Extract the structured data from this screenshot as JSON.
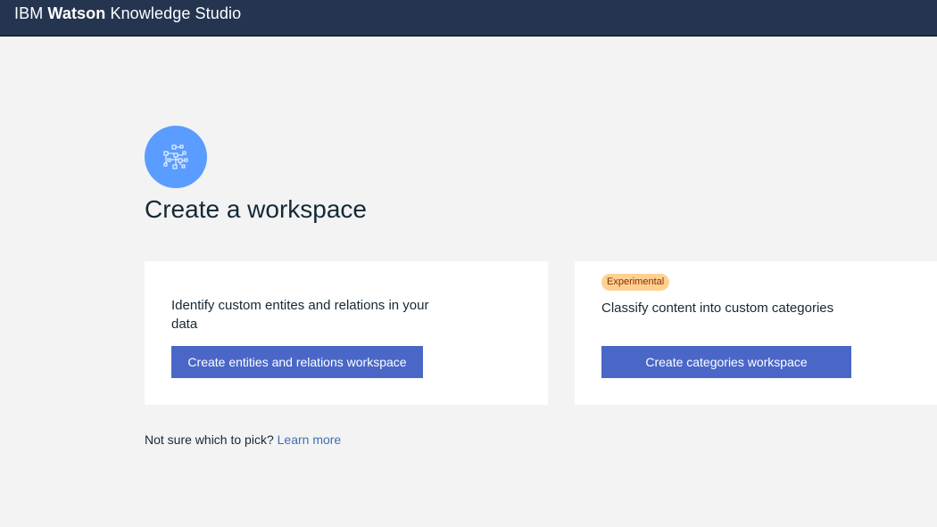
{
  "header": {
    "brand_ibm": "IBM",
    "brand_watson": "Watson",
    "brand_product": "Knowledge Studio"
  },
  "hero": {
    "icon": "workspace-network-icon",
    "icon_color": "#5a9cff",
    "title": "Create a workspace"
  },
  "cards": [
    {
      "description": "Identify custom entites and relations in your data",
      "button_label": "Create entities and relations workspace"
    },
    {
      "badge": "Experimental",
      "description": "Classify content into custom categories",
      "button_label": "Create categories workspace"
    }
  ],
  "help": {
    "prompt": "Not sure which to pick?",
    "link_label": "Learn more"
  },
  "colors": {
    "header_bg": "#253550",
    "page_bg": "#f3f3f3",
    "button_bg": "#4a67c8",
    "badge_bg": "#ffd191",
    "badge_text": "#8a2e00",
    "link": "#3d70b2"
  }
}
